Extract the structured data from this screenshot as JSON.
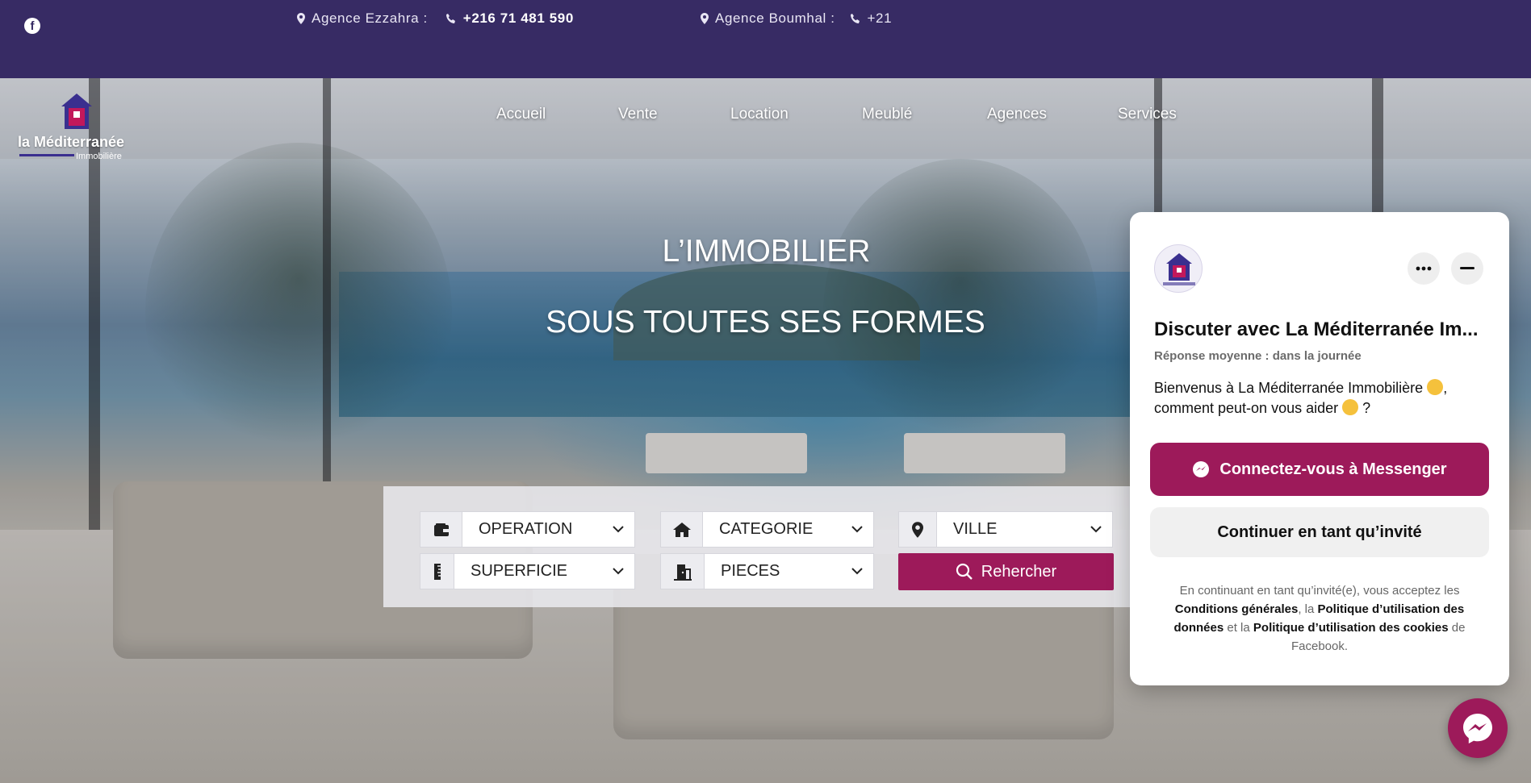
{
  "topbar": {
    "agencies": [
      {
        "name": "Agence Ezzahra :",
        "phone": "+216 71 481 590"
      },
      {
        "name": "Agence Boumhal :",
        "phone": "+21"
      }
    ],
    "social_icon": "facebook-icon"
  },
  "logo": {
    "name": "la Méditerranée",
    "sub": "Immobilière"
  },
  "nav": [
    "Accueil",
    "Vente",
    "Location",
    "Meublé",
    "Agences",
    "Services"
  ],
  "hero": {
    "line1": "L’IMMOBILIER",
    "line2": "SOUS TOUTES SES FORMES"
  },
  "search": {
    "fields": [
      {
        "label": "OPERATION",
        "icon": "wallet-icon"
      },
      {
        "label": "CATEGORIE",
        "icon": "home-icon"
      },
      {
        "label": "VILLE",
        "icon": "map-marker-icon"
      },
      {
        "label": "SUPERFICIE",
        "icon": "ruler-icon"
      },
      {
        "label": "PIECES",
        "icon": "door-icon"
      }
    ],
    "button": "Rehercher"
  },
  "chat": {
    "title": "Discuter avec La Méditerranée Im...",
    "subtitle": "Réponse moyenne : dans la journée",
    "message_line1": "Bienvenus à La Méditerranée Immobilière",
    "message_line2": "comment peut-on vous aider",
    "connect_button": "Connectez-vous à Messenger",
    "guest_button": "Continuer en tant qu’invité",
    "legal": {
      "t1": "En continuant en tant qu’invité(e), vous acceptez les",
      "l1": "Conditions générales",
      "t2": ", la",
      "l2": "Politique d’utilisation des données",
      "t3": "et la",
      "l3": "Politique d’utilisation des cookies",
      "t4": "de Facebook."
    }
  },
  "colors": {
    "topbar": "#372b64",
    "accent": "#9d1a5a"
  }
}
